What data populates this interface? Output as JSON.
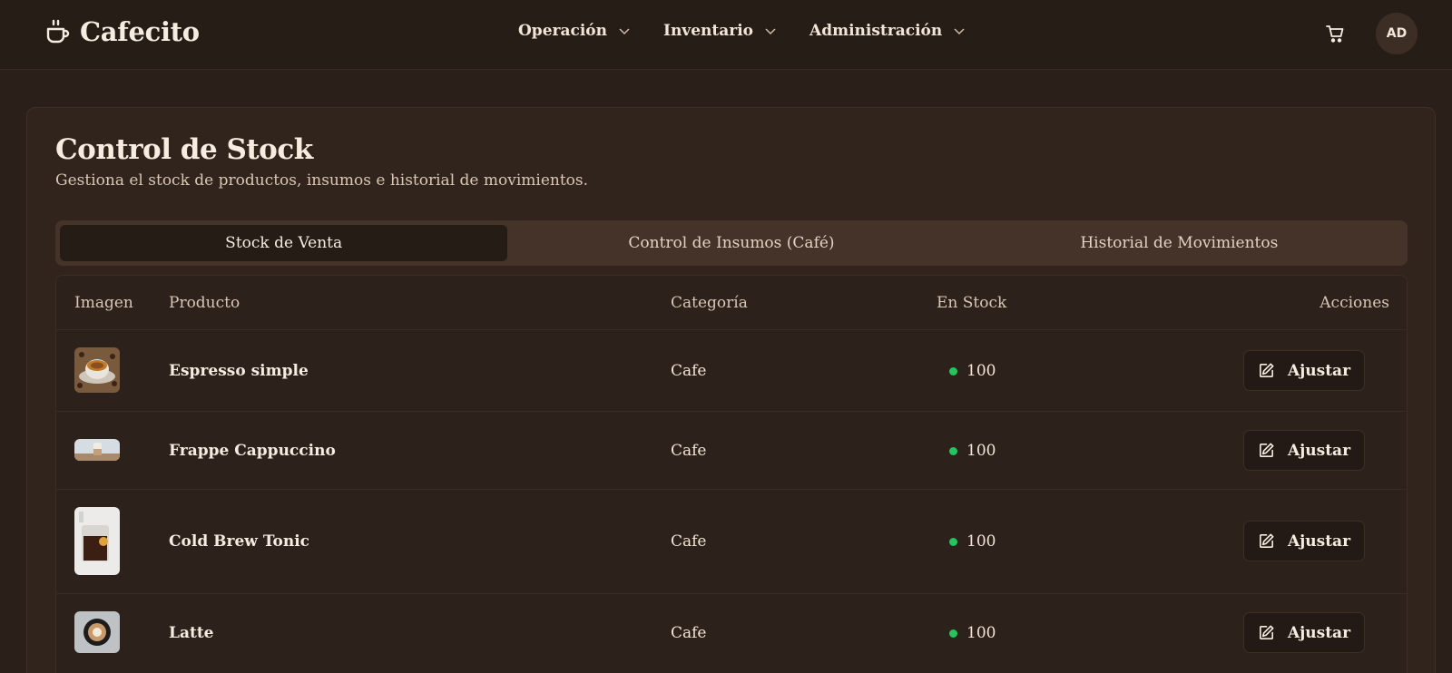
{
  "header": {
    "brand": "Cafecito",
    "nav": [
      {
        "label": "Operación"
      },
      {
        "label": "Inventario"
      },
      {
        "label": "Administración"
      }
    ],
    "avatar_initials": "AD"
  },
  "page": {
    "title": "Control de Stock",
    "subtitle": "Gestiona el stock de productos, insumos e historial de movimientos."
  },
  "tabs": [
    {
      "label": "Stock de Venta",
      "active": true
    },
    {
      "label": "Control de Insumos (Café)",
      "active": false
    },
    {
      "label": "Historial de Movimientos",
      "active": false
    }
  ],
  "table": {
    "columns": [
      "Imagen",
      "Producto",
      "Categoría",
      "En Stock",
      "Acciones"
    ],
    "rows": [
      {
        "product": "Espresso simple",
        "category": "Cafe",
        "stock": "100",
        "action": "Ajustar"
      },
      {
        "product": "Frappe Cappuccino",
        "category": "Cafe",
        "stock": "100",
        "action": "Ajustar"
      },
      {
        "product": "Cold Brew Tonic",
        "category": "Cafe",
        "stock": "100",
        "action": "Ajustar"
      },
      {
        "product": "Latte",
        "category": "Cafe",
        "stock": "100",
        "action": "Ajustar"
      }
    ]
  },
  "colors": {
    "background": "#2a1f19",
    "card": "#31241d",
    "in_stock_dot": "#22c55e"
  }
}
